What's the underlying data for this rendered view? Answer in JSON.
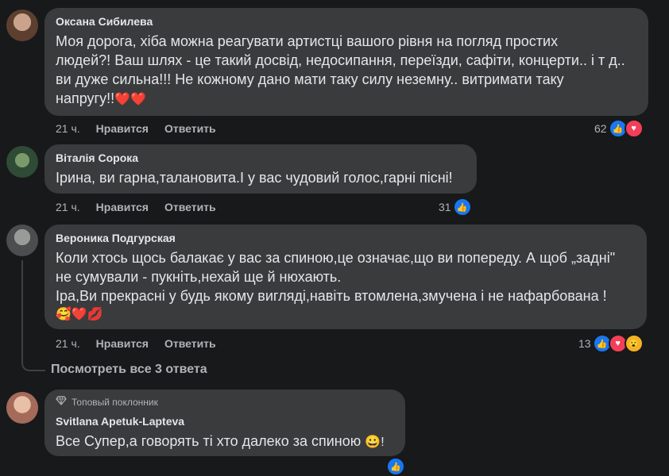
{
  "comments": [
    {
      "author": "Оксана Сибилева",
      "lines": [
        "Моя дорога, хіба можна реагувати артистці вашого рівня на погляд простих",
        "людей?! Ваш шлях - це такий досвід, недосипання, переїзди, сафіти, концерти.. і т д..",
        "ви дуже сильна!!! Не кожному дано мати таку силу неземну.. витримати таку",
        "напругу!!"
      ],
      "emoji_tail": "❤️❤️",
      "time": "21 ч.",
      "like_label": "Нравится",
      "reply_label": "Ответить",
      "reaction_count": "62",
      "reactions": [
        "like-icon",
        "love-icon"
      ],
      "avatar_color": "#8a6a58"
    },
    {
      "author": "Віталія Сорока",
      "lines": [
        "Ірина, ви гарна,талановита.І у вас чудовий голос,гарні пісні!"
      ],
      "time": "21 ч.",
      "like_label": "Нравится",
      "reply_label": "Ответить",
      "reaction_count": "31",
      "reactions": [
        "like-icon"
      ],
      "avatar_color": "#4a6b4a"
    },
    {
      "author": "Вероника Подгурская",
      "lines": [
        "Коли хтось щось балакає у вас за спиною,це означає,що ви попереду. А щоб „задні\"",
        "не сумували - пукніть,нехай ще й нюхають.",
        "Іра,Ви прекрасні у будь якому вигляді,навіть втомлена,змучена і не нафарбована !"
      ],
      "emoji_line": "🥰❤️💋",
      "time": "21 ч.",
      "like_label": "Нравится",
      "reply_label": "Ответить",
      "reaction_count": "13",
      "reactions": [
        "like-icon",
        "love-icon",
        "wow-icon"
      ],
      "avatar_color": "#6b6f72"
    },
    {
      "badge": "Топовый поклонник",
      "author": "Svitlana Apetuk-Lapteva",
      "lines": [
        "Все Супер,а говорять ті хто далеко за спиною"
      ],
      "emoji_tail": "😀!",
      "avatar_color": "#c9a08a"
    }
  ],
  "view_replies": "Посмотреть все 3 ответа",
  "colors": {
    "background": "#18191a",
    "bubble": "#3a3b3c",
    "like": "#1877f2",
    "love": "#f33e58",
    "wow": "#f7b125"
  }
}
